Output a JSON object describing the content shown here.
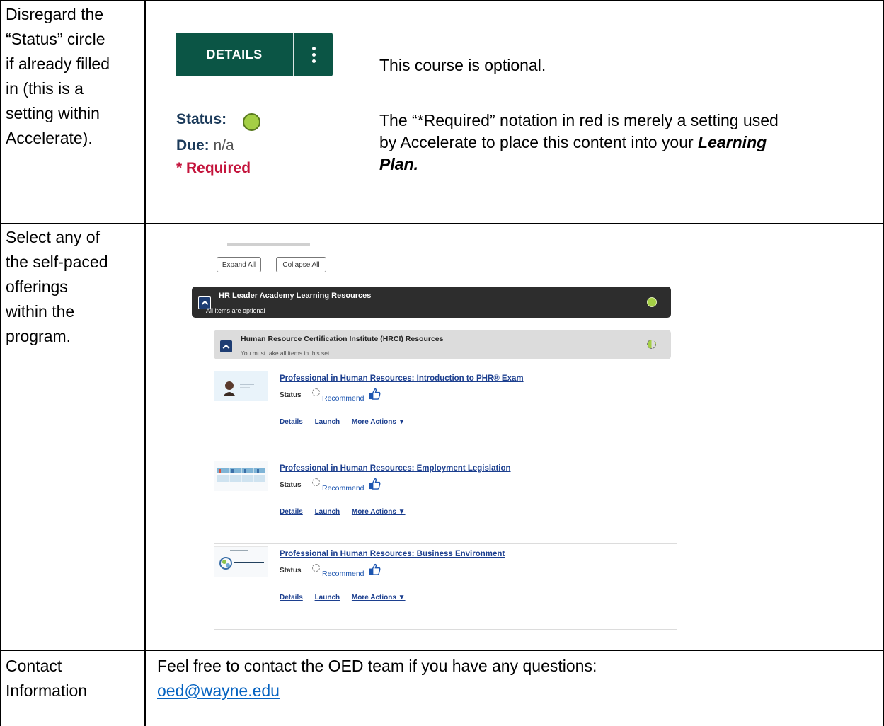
{
  "row1": {
    "left_lines": [
      "Disregard the",
      "“Status” circle",
      "if already filled",
      "in (this is a",
      "setting within",
      "Accelerate)."
    ],
    "button": {
      "label": "DETAILS",
      "more_icon": "kebab-vertical-icon"
    },
    "status_label": "Status:",
    "status_color": "#a4cf45",
    "due_label": "Due:",
    "due_value": "n/a",
    "required_label": "* Required",
    "optional_text": "This course is optional.",
    "required_note_lines": [
      "The “*Required” notation in red is merely a setting used",
      "by Accelerate to place this content into your"
    ],
    "required_note_emphasis_1": "Learning",
    "required_note_emphasis_2": "Plan."
  },
  "row2": {
    "left_lines": [
      "Select any of",
      "the self-paced",
      "offerings",
      "within the",
      "program."
    ],
    "expand_all": "Expand All",
    "collapse_all": "Collapse All",
    "program": {
      "title": "HR Leader Academy Learning Resources",
      "subtitle": "All items are optional"
    },
    "set": {
      "title": "Human Resource Certification Institute (HRCI) Resources",
      "subtitle": "You must take all items in this set"
    },
    "courses": [
      {
        "title": "Professional in Human Resources: Introduction to PHR® Exam",
        "status_label": "Status",
        "recommend": "Recommend",
        "links": [
          "Details",
          "Launch",
          "More Actions ▼"
        ]
      },
      {
        "title": "Professional in Human Resources: Employment Legislation",
        "status_label": "Status",
        "recommend": "Recommend",
        "links": [
          "Details",
          "Launch",
          "More Actions ▼"
        ]
      },
      {
        "title": "Professional in Human Resources: Business Environment",
        "status_label": "Status",
        "recommend": "Recommend",
        "links": [
          "Details",
          "Launch",
          "More Actions ▼"
        ]
      }
    ]
  },
  "row3": {
    "left_lines": [
      "Contact",
      "Information"
    ],
    "text": "Feel free to contact the OED team if you have any questions:",
    "email": "oed@wayne.edu"
  }
}
